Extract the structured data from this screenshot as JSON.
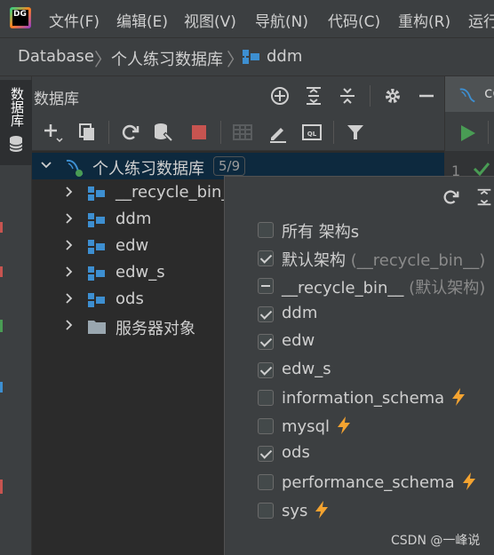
{
  "menubar": {
    "logo_text": "DG",
    "items": [
      "文件(F)",
      "编辑(E)",
      "视图(V)",
      "导航(N)",
      "代码(C)",
      "重构(R)",
      "运行"
    ]
  },
  "breadcrumb": {
    "items": [
      "Database",
      "个人练习数据库",
      "ddm"
    ]
  },
  "left_strip": {
    "tab_label": "数据库"
  },
  "panel": {
    "title": "数据库"
  },
  "tree": {
    "root": {
      "label": "个人练习数据库",
      "badge": "5/9"
    },
    "children": [
      {
        "label": "__recycle_bin__",
        "icon": "schema-icon"
      },
      {
        "label": "ddm",
        "icon": "schema-icon"
      },
      {
        "label": "edw",
        "icon": "schema-icon"
      },
      {
        "label": "edw_s",
        "icon": "schema-icon"
      },
      {
        "label": "ods",
        "icon": "schema-icon"
      },
      {
        "label": "服务器对象",
        "icon": "folder-icon"
      }
    ]
  },
  "editor": {
    "tab_label": "co",
    "line_number": "1"
  },
  "popup": {
    "options": [
      {
        "label": "所有 架构s",
        "hint": "",
        "state": "unchecked",
        "bolt": false
      },
      {
        "label": "默认架构",
        "hint": "(__recycle_bin__)",
        "state": "checked",
        "bolt": false
      },
      {
        "label": "__recycle_bin__",
        "hint": "(默认架构)",
        "state": "indeterminate",
        "bolt": false
      },
      {
        "label": "ddm",
        "hint": "",
        "state": "checked",
        "bolt": false
      },
      {
        "label": "edw",
        "hint": "",
        "state": "checked",
        "bolt": false
      },
      {
        "label": "edw_s",
        "hint": "",
        "state": "checked",
        "bolt": false
      },
      {
        "label": "information_schema",
        "hint": "",
        "state": "unchecked",
        "bolt": true
      },
      {
        "label": "mysql",
        "hint": "",
        "state": "unchecked",
        "bolt": true
      },
      {
        "label": "ods",
        "hint": "",
        "state": "checked",
        "bolt": false
      },
      {
        "label": "performance_schema",
        "hint": "",
        "state": "unchecked",
        "bolt": true
      },
      {
        "label": "sys",
        "hint": "",
        "state": "unchecked",
        "bolt": true
      }
    ]
  },
  "watermark": "CSDN @一峰说",
  "colors": {
    "accent_blue": "#3d8fd1",
    "stop_red": "#c75450",
    "run_green": "#499c54",
    "bolt_orange": "#f4a330",
    "selection": "#0d293e"
  }
}
